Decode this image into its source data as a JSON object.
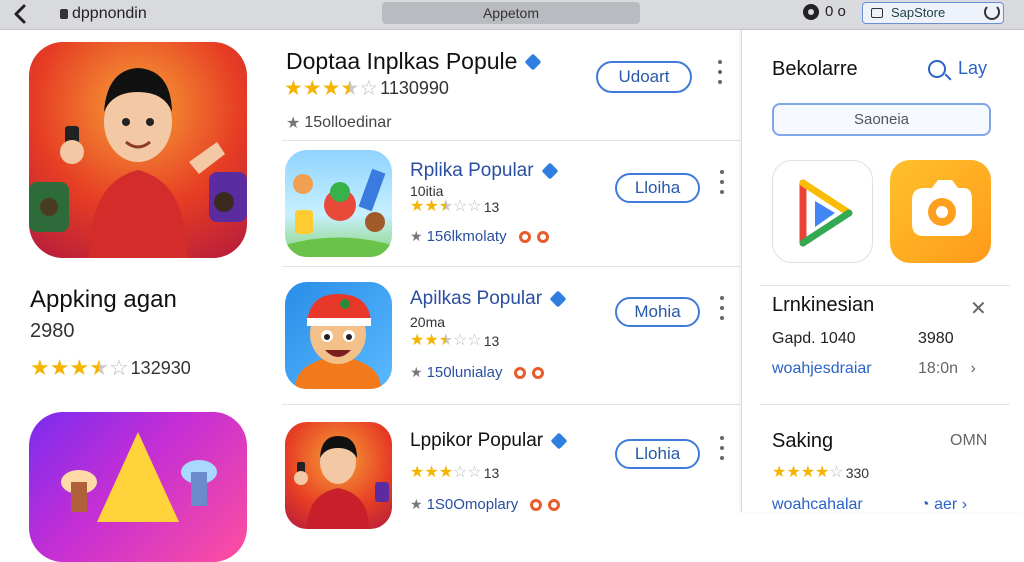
{
  "topbar": {
    "app_title": "dppnondin",
    "center_pill": "Appetom",
    "status_text": "0 o",
    "store_label": "SapStore"
  },
  "featured": {
    "name": "Appking agan",
    "subtitle": "2980",
    "rating": 3.5,
    "rating_count": "132930"
  },
  "main": {
    "title": "Doptaa Inplkas Popule",
    "rating": 3.5,
    "rating_count": "1130990",
    "meta": "15olloedinar",
    "button_label": "Udoart"
  },
  "rows": [
    {
      "name": "Rplika Popular",
      "subtitle": "10itia",
      "rating": 2.5,
      "rating_count": "13",
      "meta": "156lkmolaty",
      "button_label": "Lloiha"
    },
    {
      "name": "Apilkas Popular",
      "subtitle": "20ma",
      "rating": 2.5,
      "rating_count": "13",
      "meta": "150lunialay",
      "button_label": "Mohia"
    },
    {
      "name": "Lppikor Popular",
      "subtitle": "",
      "rating": 3,
      "rating_count": "13",
      "meta": "1S0Omoplary",
      "button_label": "Llohia"
    }
  ],
  "right_panel": {
    "title": "Bekolarre",
    "link": "Lay",
    "search_text": "Saoneia",
    "section1_title": "Lrnkinesian",
    "section1_line_left": "Gapd. 1040",
    "section1_line_right": "3980",
    "section1_link": "woahjesdraiar",
    "section1_time": "18:0n",
    "section2_title": "Saking",
    "section2_right": "OMN",
    "section2_rating": 4,
    "section2_count": "330",
    "section2_link": "woahcahalar",
    "section2_tail": "aer"
  },
  "colors": {
    "accent": "#2b63c9",
    "star": "#f4b400",
    "topbar": "#d9dadd"
  }
}
